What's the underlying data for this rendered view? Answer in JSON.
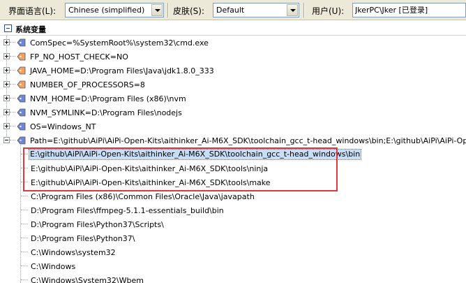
{
  "toolbar": {
    "language_label": "界面语言(L):",
    "language_value": "Chinese (simplified)",
    "skin_label": "皮肤(S):",
    "skin_value": "Default",
    "user_label": "用户(U):",
    "user_value": "JkerPC\\Jker [已登录]"
  },
  "group": {
    "title": "系统变量"
  },
  "colors": {
    "tag_blue": "#6f86d6",
    "tag_orange": "#f0a060",
    "selection": "#c8ddf6",
    "highlight_border": "#e0383f"
  },
  "variables": [
    {
      "text": "ComSpec=%SystemRoot%\\system32\\cmd.exe",
      "icon": "blue-tag-icon"
    },
    {
      "text": "FP_NO_HOST_CHECK=NO",
      "icon": "orange-tag-icon"
    },
    {
      "text": "JAVA_HOME=D:\\Program Files\\Java\\jdk1.8.0_333",
      "icon": "orange-tag-icon"
    },
    {
      "text": "NUMBER_OF_PROCESSORS=8",
      "icon": "orange-tag-icon"
    },
    {
      "text": "NVM_HOME=D:\\Program Files (x86)\\nvm",
      "icon": "blue-tag-icon"
    },
    {
      "text": "NVM_SYMLINK=D:\\Program Files\\nodejs",
      "icon": "blue-tag-icon"
    },
    {
      "text": "OS=Windows_NT",
      "icon": "blue-tag-icon"
    },
    {
      "text": "Path=E:\\github\\AiPi\\AiPi-Open-Kits\\aithinker_Ai-M6X_SDK\\toolchain_gcc_t-head_windows\\bin;E:\\github\\AiPi\\AiPi-Open-Kits\\aithinker_Ai-M6X_SDK\\tools\\ninja;E:\\github\\AiPi\\AiPi-Open-Kits\\aithinker_Ai-M6X_SDK\\tools\\make",
      "icon": "blue-tag-icon"
    }
  ],
  "path_entries": [
    "E:\\github\\AiPi\\AiPi-Open-Kits\\aithinker_Ai-M6X_SDK\\toolchain_gcc_t-head_windows\\bin",
    "E:\\github\\AiPi\\AiPi-Open-Kits\\aithinker_Ai-M6X_SDK\\tools\\ninja",
    "E:\\github\\AiPi\\AiPi-Open-Kits\\aithinker_Ai-M6X_SDK\\tools\\make",
    "C:\\Program Files (x86)\\Common Files\\Oracle\\Java\\javapath",
    "D:\\Program Files\\ffmpeg-5.1.1-essentials_build\\bin",
    "D:\\Program Files\\Python37\\Scripts\\",
    "D:\\Program Files\\Python37\\",
    "C:\\Windows\\system32",
    "C:\\Windows",
    "C:\\Windows\\System32\\Wbem"
  ]
}
